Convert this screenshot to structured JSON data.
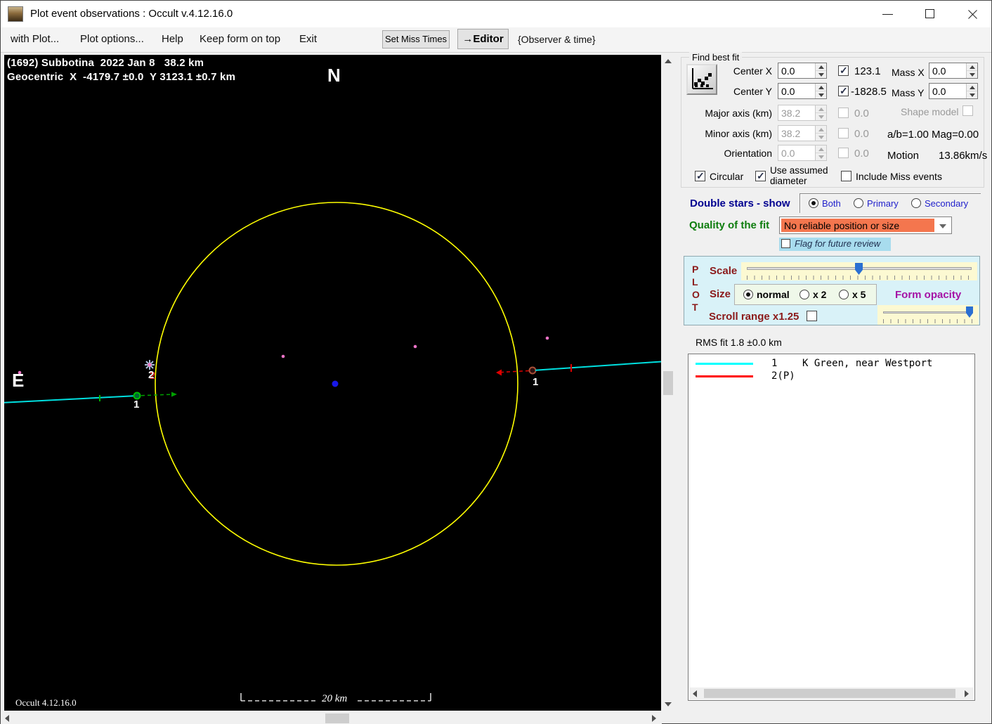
{
  "window": {
    "title": "Plot event observations : Occult v.4.12.16.0"
  },
  "menu": {
    "items": [
      "with Plot...",
      "Plot options...",
      "Help",
      "Keep form on top",
      "Exit"
    ],
    "set_miss_times_button": "Set Miss Times",
    "editor_button": "→Editor",
    "observer_time_label": "{Observer & time}"
  },
  "plot": {
    "header_line1": "(1692) Subbotina  2022 Jan 8   38.2 km",
    "header_line2": "Geocentric  X  -4179.7 ±0.0  Y 3123.1 ±0.7 km",
    "north_label": "N",
    "east_label": "E",
    "chord1_observed_label": "1",
    "chord1_predicted_label": "1",
    "star2_label": "2",
    "scale_bar_label": "20 km",
    "version_label": "Occult 4.12.16.0",
    "colors": {
      "circle": "#ffff00",
      "chord": "#00e0e0",
      "observed_green": "#00b000",
      "predicted_red": "#e00000",
      "center_dot": "#1818e8",
      "star_dots": "#ee74c8"
    }
  },
  "find_best_fit": {
    "title": "Find best fit",
    "best_fit_icon": "scatter-fit-chart",
    "center_x_label": "Center X",
    "center_x_value": "0.0",
    "center_y_label": "Center Y",
    "center_y_value": "0.0",
    "fit_x_value": "123.1",
    "fit_y_value": "-1828.5",
    "mass_x_label": "Mass X",
    "mass_x_value": "0.0",
    "mass_y_label": "Mass Y",
    "mass_y_value": "0.0",
    "major_axis_label": "Major axis (km)",
    "major_axis_value": "38.2",
    "major_axis_aux": "0.0",
    "minor_axis_label": "Minor axis (km)",
    "minor_axis_value": "38.2",
    "minor_axis_aux": "0.0",
    "orientation_label": "Orientation",
    "orientation_value": "0.0",
    "orientation_aux": "0.0",
    "shape_model_label": "Shape model",
    "ab_mag_label": "a/b=1.00 Mag=0.00",
    "motion_label": "Motion",
    "motion_value": "13.86km/s",
    "circular_label": "Circular",
    "use_assumed_line1": "Use assumed",
    "use_assumed_line2": "diameter",
    "include_miss_label": "Include Miss events"
  },
  "double_stars": {
    "label": "Double stars - show",
    "options": [
      "Both",
      "Primary",
      "Secondary"
    ],
    "selected": "Both"
  },
  "quality": {
    "label": "Quality of the fit",
    "value": "No reliable position or size",
    "value_bg": "#f4764e",
    "flag_label": "Flag for future review",
    "flag_bg": "#a8dcee"
  },
  "plot_controls": {
    "letters": [
      "P",
      "L",
      "O",
      "T"
    ],
    "scale_label": "Scale",
    "size_label": "Size",
    "size_options": [
      "normal",
      "x 2",
      "x 5"
    ],
    "selected_size": "normal",
    "form_opacity_label": "Form opacity",
    "scroll_range_label": "Scroll range x1.25",
    "panel_bg": "#d9f2f8",
    "slider_bg": "#fcf9d2"
  },
  "rms_label": "RMS fit 1.8 ±0.0 km",
  "legend": {
    "items": [
      {
        "color": "#00ffff",
        "num": "1",
        "name": "K Green, near Westport"
      },
      {
        "color": "#ff0000",
        "num": "2(P)",
        "name": ""
      }
    ]
  }
}
